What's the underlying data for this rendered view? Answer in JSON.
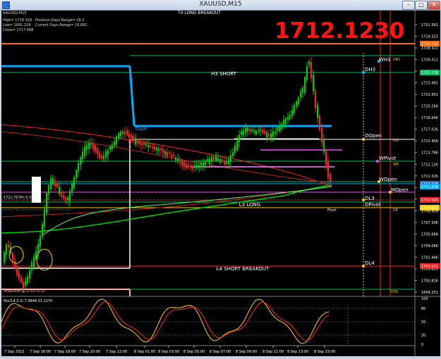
{
  "window": {
    "title": "XAUUSD,M15",
    "controls": {
      "minimize": "–",
      "maximize": "□",
      "close": "✕"
    }
  },
  "info": {
    "symbol": "XAUUSD,M15",
    "high": "High= 1719.318",
    "low": "Low= 1691.218",
    "close": "Close= 1717.998",
    "prev_range": "Previous Days Range= 28.1",
    "curr_range": "Current Days Range= 16.881"
  },
  "big_price": "1712.1230",
  "top_label": "T4 LONG BREAKOUT",
  "price_axis": [
    "1731.561",
    "1729.323",
    "1728.321",
    "1726.411",
    "1725.776",
    "1723.461",
    "1721.951",
    "1720.266",
    "1718.646",
    "1717.026",
    "1715.406",
    "1713.786",
    "1712.126",
    "1711.326",
    "1710.545",
    "1709.581",
    "1708.926",
    "1707.306",
    "1705.686",
    "1704.066",
    "1702.446",
    "1701.451",
    "1700.826",
    "1699.251"
  ],
  "price_tags": [
    {
      "text": "1729.323",
      "color": "#ff6a00"
    },
    {
      "text": "1725.776",
      "color": "#00c060"
    },
    {
      "text": "1712.126",
      "color": "#2a74d6"
    },
    {
      "text": "1711.326",
      "color": "#00b0ff"
    },
    {
      "text": "1710.545",
      "color": "#ff2020"
    },
    {
      "text": "1709.581",
      "color": "#ffd000"
    },
    {
      "text": "1701.451",
      "color": "#ff2020"
    }
  ],
  "levels": {
    "h3_short": "H3 SHORT",
    "l3_long": "L3 LONG",
    "l4_short_breakout": "L4 SHORT BREAKOUT",
    "dayh": "DayH",
    "wh3": "WH3",
    "dh3": "DH3",
    "dopen": "DOpen",
    "wpivot": "WPivot",
    "wopen": "WOpen",
    "mopen": "MOpen",
    "dl3": "DL3",
    "dpivot": "DPivot",
    "dl4": "DL4",
    "pivot": "Pivot",
    "dr1": "DR1",
    "do": "DO",
    "wp": "WP",
    "dp": "DP",
    "ds1": "DS1",
    "left_level": "1711.70 Pin 0 (0)",
    "snapshot": "SnapShot @ 1703 (1:1)"
  },
  "stoch": {
    "label": "Sto(14,3,3) 7.9849 31.1270",
    "levels": [
      "100",
      "80",
      "50",
      "20",
      "0"
    ]
  },
  "time_axis": [
    "7 Sep 2022",
    "7 Sep 16:00",
    "7 Sep 18:00",
    "7 Sep 20:00",
    "7 Sep 22:00",
    "8 Sep 01:00",
    "8 Sep 03:00",
    "8 Sep 05:00",
    "8 Sep 07:00",
    "8 Sep 09:00",
    "8 Sep 11:00",
    "8 Sep 13:00",
    "8 Sep 15:00"
  ],
  "colors": {
    "bull": "#00d000",
    "bear": "#ff2020",
    "h3": "#00c060",
    "blue_line": "#00aaff",
    "orange_line": "#ff6a00",
    "magenta": "#ff44ff",
    "yellow": "#ffd000"
  }
}
